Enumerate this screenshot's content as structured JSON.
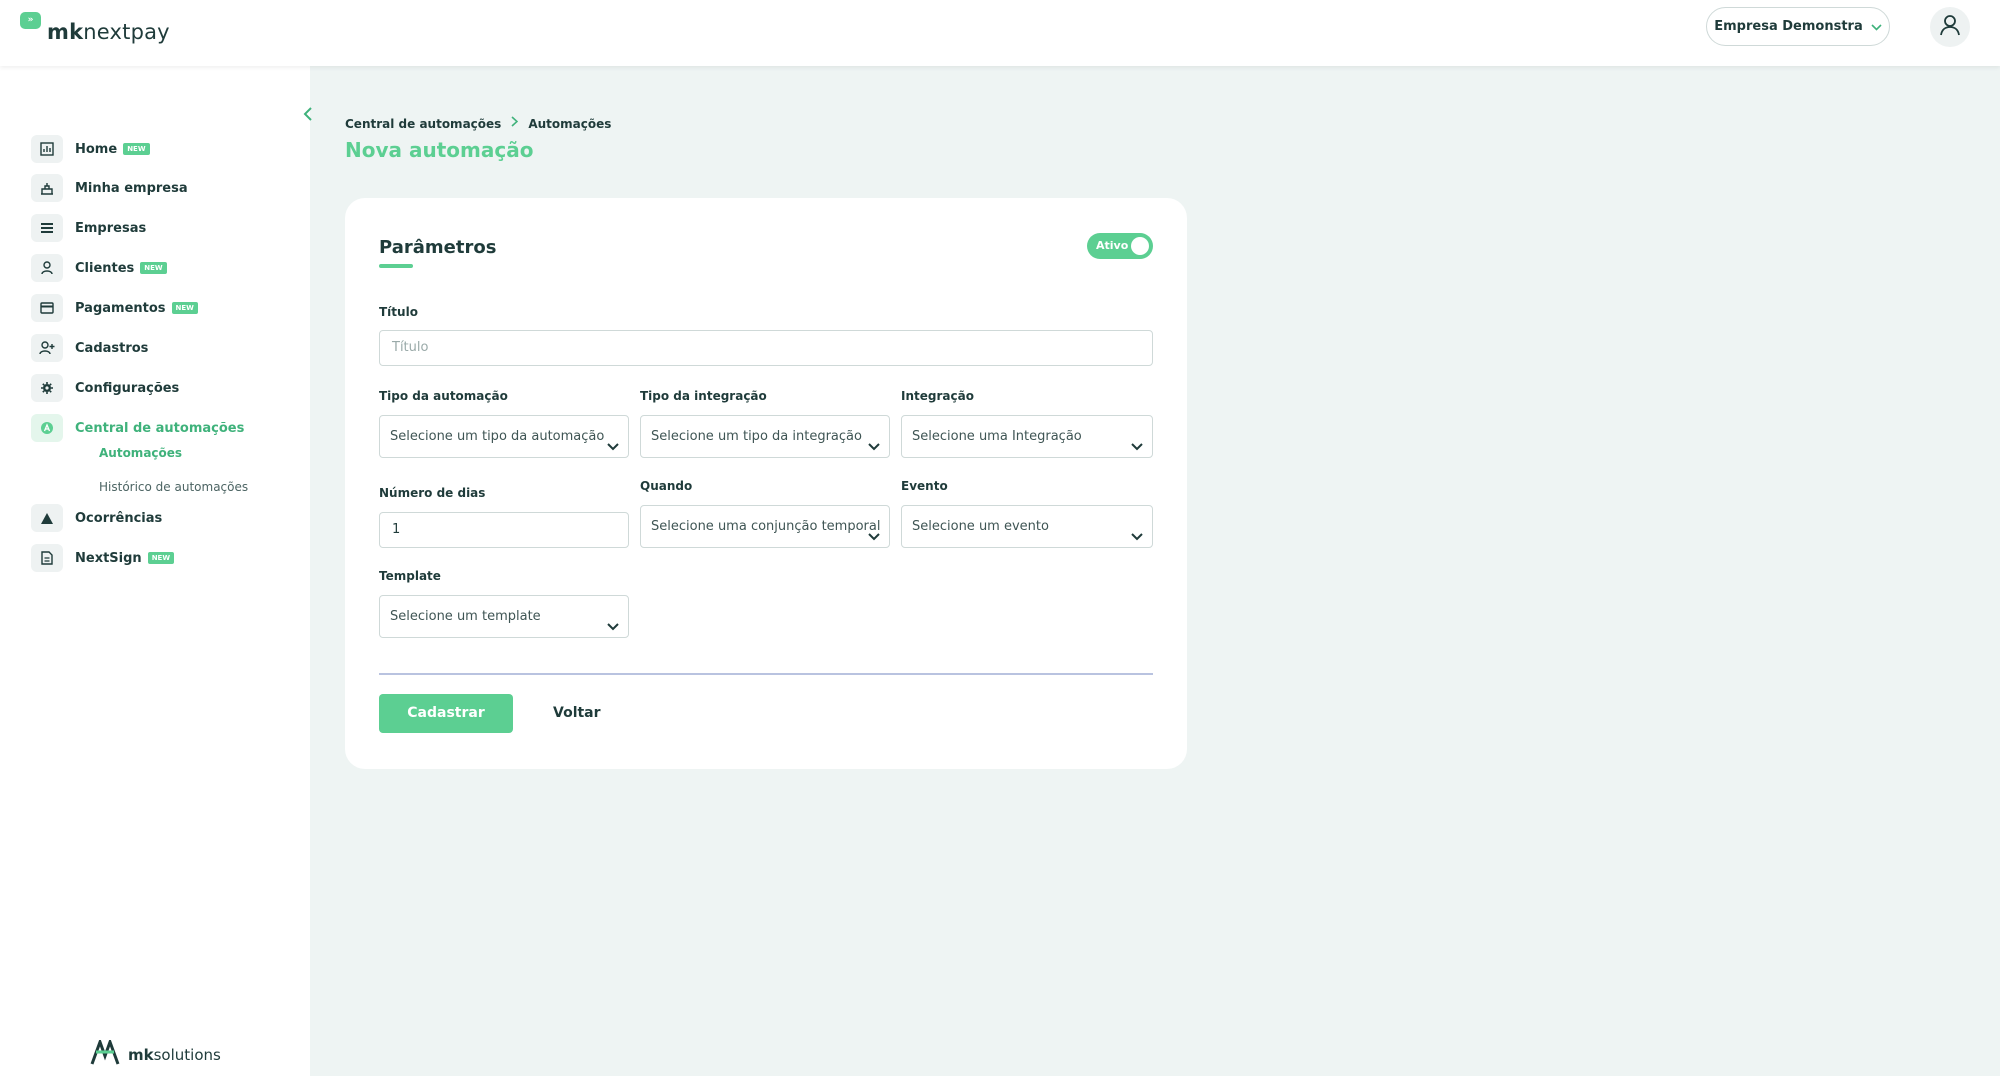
{
  "brand": {
    "mark": "»",
    "name_bold": "mk",
    "name_rest": "nextpay"
  },
  "header": {
    "company": "Empresa Demonstra"
  },
  "sidebar": {
    "items": [
      {
        "label": "Home",
        "badge": "NEW"
      },
      {
        "label": "Minha empresa"
      },
      {
        "label": "Empresas"
      },
      {
        "label": "Clientes",
        "badge": "NEW"
      },
      {
        "label": "Pagamentos",
        "badge": "NEW"
      },
      {
        "label": "Cadastros"
      },
      {
        "label": "Configurações"
      },
      {
        "label": "Central de automações",
        "active": true
      },
      {
        "label": "Ocorrências"
      },
      {
        "label": "NextSign",
        "badge": "NEW"
      }
    ],
    "subitems": [
      {
        "label": "Automações",
        "active": true
      },
      {
        "label": "Histórico de automações"
      }
    ],
    "footer": {
      "bold": "mk",
      "rest": "solutions"
    }
  },
  "breadcrumb": {
    "parent": "Central de automações",
    "current": "Automações"
  },
  "page": {
    "title": "Nova automação"
  },
  "form": {
    "section_title": "Parâmetros",
    "status_toggle": {
      "label": "Ativo",
      "on": true
    },
    "titulo": {
      "label": "Título",
      "placeholder": "Título"
    },
    "tipo_automacao": {
      "label": "Tipo da automação",
      "value": "Selecione um tipo da automação"
    },
    "tipo_integracao": {
      "label": "Tipo da integração",
      "value": "Selecione um tipo da integração"
    },
    "integracao": {
      "label": "Integração",
      "value": "Selecione uma Integração"
    },
    "numero_dias": {
      "label": "Número de dias",
      "value": "1"
    },
    "quando": {
      "label": "Quando",
      "value": "Selecione uma conjunção temporal"
    },
    "evento": {
      "label": "Evento",
      "value": "Selecione um evento"
    },
    "template": {
      "label": "Template",
      "value": "Selecione um template"
    },
    "submit_label": "Cadastrar",
    "back_label": "Voltar"
  },
  "colors": {
    "accent": "#5ccf92",
    "accent_dark": "#3fb27b",
    "text": "#1f3b3a",
    "background": "#eef4f3"
  }
}
